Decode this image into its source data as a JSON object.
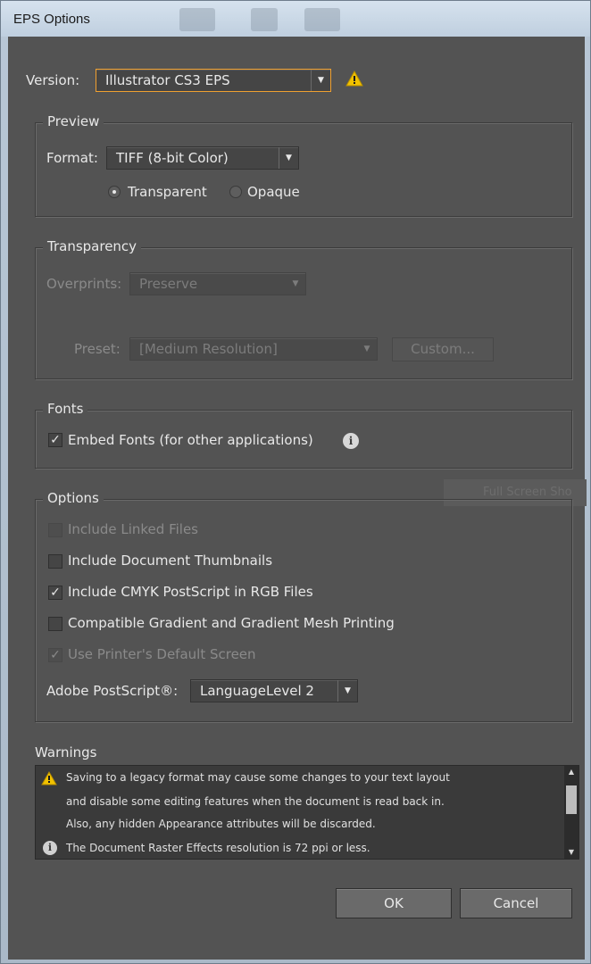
{
  "window": {
    "title": "EPS Options"
  },
  "version": {
    "label": "Version:",
    "value": "Illustrator CS3 EPS"
  },
  "preview": {
    "legend": "Preview",
    "format_label": "Format:",
    "format_value": "TIFF (8-bit Color)",
    "transparent_label": "Transparent",
    "opaque_label": "Opaque"
  },
  "transparency": {
    "legend": "Transparency",
    "overprints_label": "Overprints:",
    "overprints_value": "Preserve",
    "preset_label": "Preset:",
    "preset_value": "[Medium Resolution]",
    "custom_button": "Custom..."
  },
  "fonts": {
    "legend": "Fonts",
    "embed_label": "Embed Fonts (for other applications)"
  },
  "options": {
    "legend": "Options",
    "include_linked": "Include Linked Files",
    "include_thumbnails": "Include Document Thumbnails",
    "include_cmyk": "Include CMYK PostScript in RGB Files",
    "compatible_gradient": "Compatible Gradient and Gradient Mesh Printing",
    "use_printer_screen": "Use Printer's Default Screen",
    "postscript_label": "Adobe PostScript®:",
    "postscript_value": "LanguageLevel 2"
  },
  "warnings": {
    "label": "Warnings",
    "line1": "Saving to a legacy format may cause some changes to your text layout",
    "line2": "and disable some editing features when the document is read back in.",
    "line3": "Also, any hidden Appearance attributes will be discarded.",
    "line4": "The Document Raster Effects resolution is 72 ppi or less."
  },
  "buttons": {
    "ok": "OK",
    "cancel": "Cancel"
  },
  "glyphs": {
    "check": "✓",
    "arrow": "▼",
    "info": "i",
    "up": "▲",
    "down": "▼"
  },
  "icons": {
    "warning": "warning-icon",
    "info": "info-icon"
  },
  "colors": {
    "panel": "#535353",
    "focus": "#f0a030",
    "warning": "#f2c200"
  }
}
